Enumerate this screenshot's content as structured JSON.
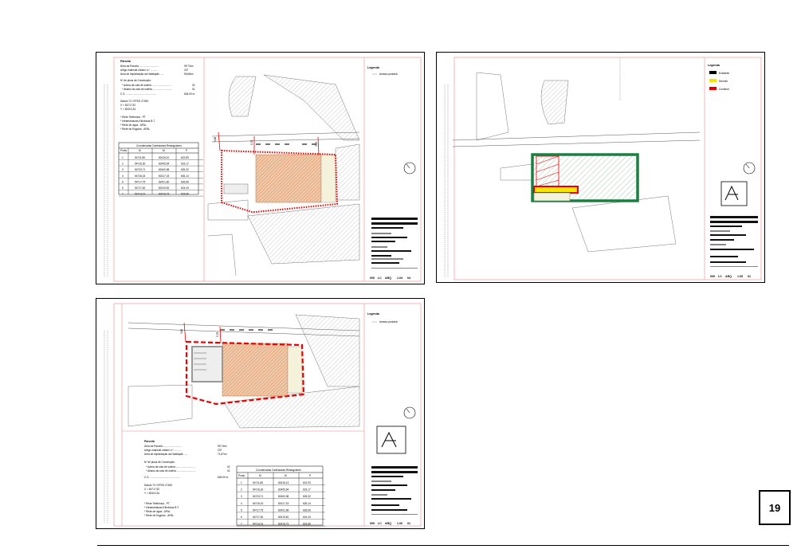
{
  "page_number": "19",
  "sheet1": {
    "parcel": {
      "title": "Parcela",
      "area_parcela": "Área da Parcela ...........................",
      "area_parcela_val": "99,73m²",
      "artigo": "Artigo matricial urbano n.º ..........",
      "artigo_val": "237",
      "area_implantacao": "Área de implantação da Habitação .....",
      "area_implantacao_val": "59,68m²",
      "pisos": "Nº de pisos de Construção:",
      "acima": "* Acima da cota de soleira ...........................",
      "acima_val": "02",
      "abaixo": "* Abaixo da cota de soleira ...........................",
      "abaixo_val": "01",
      "cs": "C.S. ...........................................",
      "cs_val": "626,00 m",
      "datum": "Datum 73 / EPSG 27493",
      "x": "X = 54717,52",
      "y": "Y = 82410,34",
      "rede1": "* Rede Telefónica - PT",
      "rede2": "* Infraestruturas Eléctricas B.T.",
      "rede3": "* Rede de água - APAL",
      "rede4": "* Rede de Esgotos - APAL"
    },
    "coords_title": "Coordenadas Cartesianas Retangulares",
    "coords_header": [
      "Ponto",
      "M",
      "M",
      "P"
    ],
    "coords_rows": [
      [
        "1",
        "54711,89",
        "82415,10",
        "622,89"
      ],
      [
        "2",
        "54716,30",
        "82405,54",
        "623,17"
      ],
      [
        "3",
        "54723,71",
        "82400,58",
        "625,32"
      ],
      [
        "4",
        "54716,15",
        "82417,15",
        "626,14"
      ],
      [
        "5",
        "54717,75",
        "82421,60",
        "626,66"
      ],
      [
        "6",
        "54717,62",
        "82419,81",
        "624,43"
      ],
      [
        "7",
        "54713,01",
        "82415,73",
        "623,66"
      ]
    ],
    "legend_title": "Legenda",
    "legend_item": "Acesso pedonal"
  },
  "sheet2": {
    "legend_title": "Legenda",
    "legend_items": [
      {
        "label": "Existente",
        "color": "#000000"
      },
      {
        "label": "Demolir",
        "color": "#f2e600"
      },
      {
        "label": "Construir",
        "color": "#e00000"
      }
    ]
  },
  "sheet3": {
    "parcel": {
      "title": "Parcela",
      "area_parcela": "Área da Parcela ...........................",
      "area_parcela_val": "99,73m²",
      "artigo": "Artigo matricial urbano n.º ..........",
      "artigo_val": "237",
      "area_implantacao": "Área de implantação da Habitação .....",
      "area_implantacao_val": "71,87m²",
      "pisos": "Nº de pisos de Construção:",
      "acima": "* Acima da cota de soleira ...........................",
      "acima_val": "02",
      "abaixo": "* Abaixo da cota de soleira ...........................",
      "abaixo_val": "01",
      "cs": "C.S. ...........................................",
      "cs_val": "626,00 m",
      "datum": "Datum 73 / EPSG 27493",
      "x": "X = 54717,52",
      "y": "Y = 82410,34",
      "rede1": "* Rede Telefónica - PT",
      "rede2": "* Infraestruturas Eléctricas B.T.",
      "rede3": "* Rede de água - APAL",
      "rede4": "* Rede de Esgotos - APAL"
    },
    "coords_title": "Coordenadas Cartesianas Retangulares",
    "coords_header": [
      "Ponto",
      "M",
      "M",
      "P"
    ],
    "coords_rows": [
      [
        "1",
        "54711,89",
        "82415,13",
        "622,93"
      ],
      [
        "2",
        "54716,30",
        "82405,54",
        "623,17"
      ],
      [
        "3",
        "54723,71",
        "82400,38",
        "625,32"
      ],
      [
        "4",
        "54716,15",
        "82417,15",
        "626,14"
      ],
      [
        "5",
        "54717,75",
        "82421,98",
        "626,66"
      ],
      [
        "6",
        "54717,62",
        "82419,81",
        "624,43"
      ],
      [
        "7",
        "54713,01",
        "82415,73",
        "623,66"
      ]
    ],
    "legend_title": "Legenda",
    "legend_item": "Acesso pedonal"
  },
  "dim_labels": {
    "d1": "3,68",
    "d2": "5,78",
    "d3": "3,52"
  },
  "title_block": {
    "code": "ARQ",
    "prefix": "LC",
    "sheet1_num": "1.04",
    "sheet1_total": "04",
    "sheet1_left": "009",
    "sheet2_num": "1.05",
    "sheet2_total": "01",
    "sheet2_left": "009",
    "sheet3_num": "1.06",
    "sheet3_total": "01",
    "sheet3_left": "009"
  }
}
